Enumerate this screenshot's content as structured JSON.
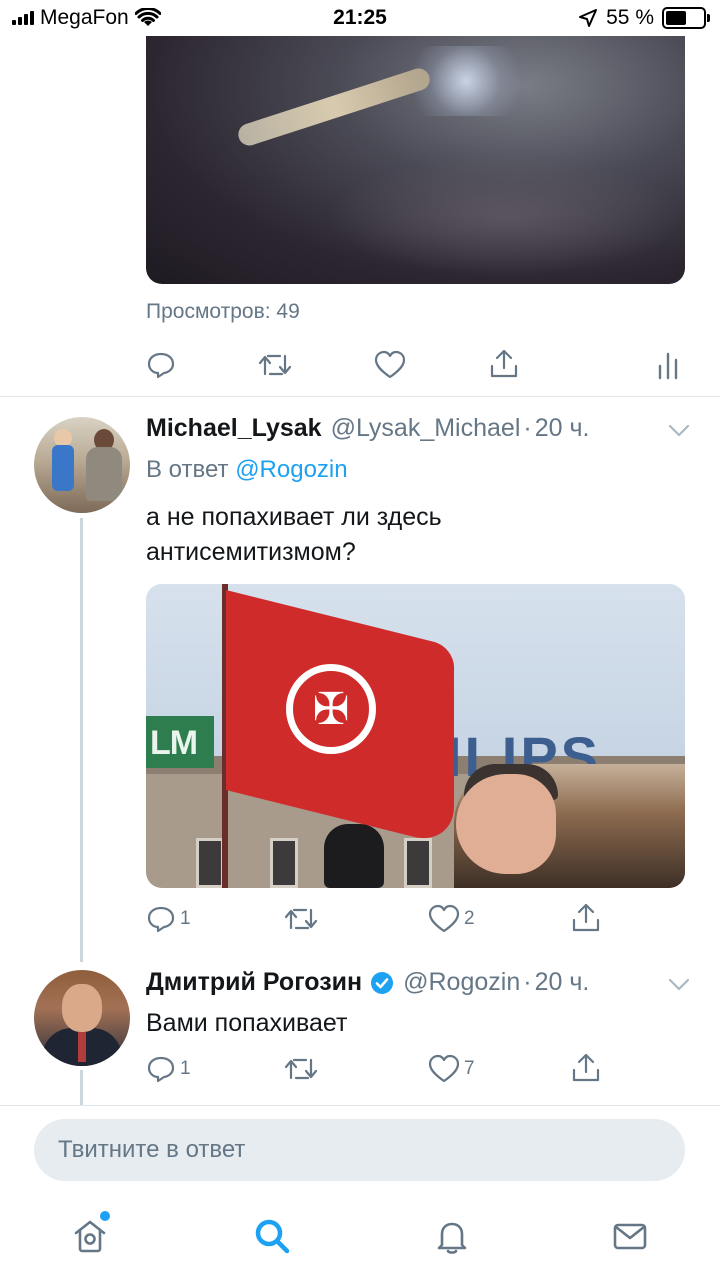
{
  "status_bar": {
    "carrier": "MegaFon",
    "time": "21:25",
    "battery_percent": "55 %",
    "battery_level": 0.55
  },
  "top_tweet": {
    "views_label": "Просмотров: 49"
  },
  "reply_tweet": {
    "name": "Michael_Lysak",
    "handle": "@Lysak_Michael",
    "separator": "·",
    "time": "20 ч.",
    "reply_prefix": "В ответ",
    "reply_to": "@Rogozin",
    "text_line1": "а не попахивает ли здесь",
    "text_line2": "антисемитизмом?",
    "photo_sign_left": "LM",
    "photo_sign_right": "ILIPS",
    "reply_count": "1",
    "like_count": "2"
  },
  "author_reply": {
    "name": "Дмитрий Рогозин",
    "handle": "@Rogozin",
    "separator": "·",
    "time": "20 ч.",
    "text": "Вами попахивает",
    "reply_count": "1",
    "like_count": "7"
  },
  "reply_input": {
    "placeholder": "Твитните в ответ"
  },
  "tabs": [
    "home-icon",
    "search-icon",
    "notifications-icon",
    "messages-icon"
  ],
  "colors": {
    "accent": "#1da1f2",
    "muted": "#657786",
    "divider": "#e1e8ed"
  }
}
